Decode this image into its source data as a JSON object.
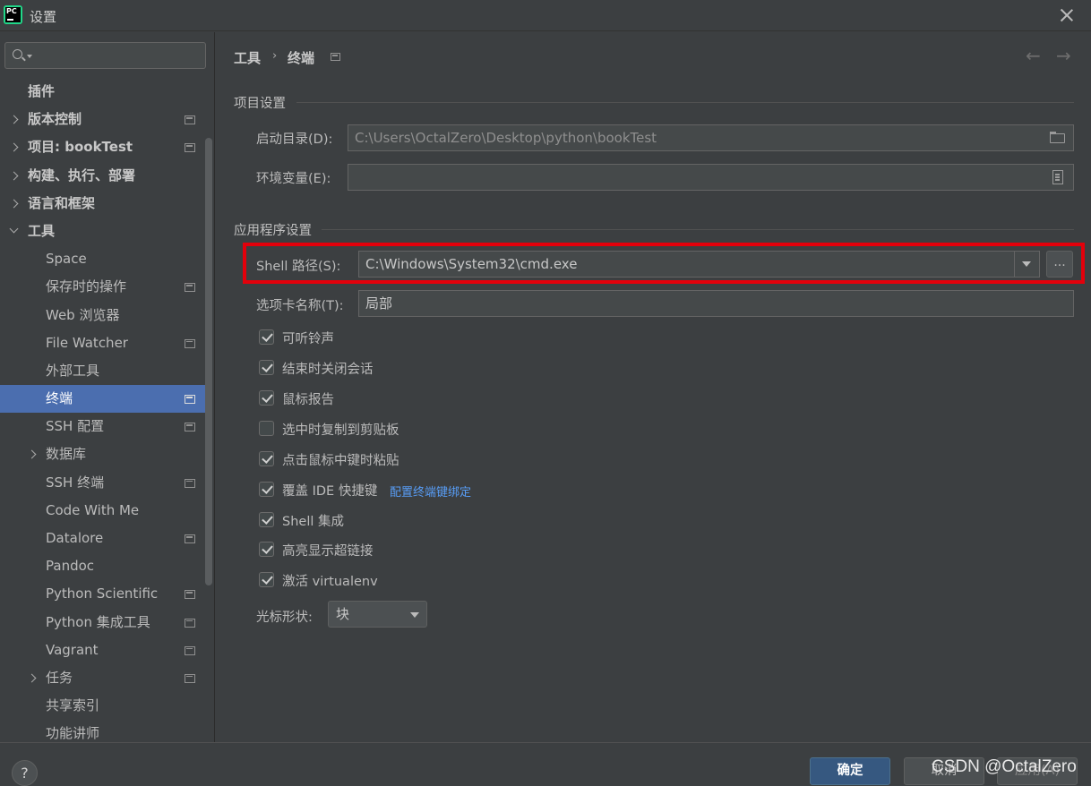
{
  "window": {
    "title": "设置"
  },
  "sidebar": {
    "search": {
      "value": "",
      "placeholder": ""
    },
    "items": [
      {
        "label": "插件",
        "level": 0,
        "expander": "none",
        "bold": true,
        "selected": false,
        "has_icon": false
      },
      {
        "label": "版本控制",
        "level": 0,
        "expander": "right",
        "bold": true,
        "selected": false,
        "has_icon": true
      },
      {
        "label": "项目: bookTest",
        "level": 0,
        "expander": "right",
        "bold": true,
        "selected": false,
        "has_icon": true
      },
      {
        "label": "构建、执行、部署",
        "level": 0,
        "expander": "right",
        "bold": true,
        "selected": false,
        "has_icon": false
      },
      {
        "label": "语言和框架",
        "level": 0,
        "expander": "right",
        "bold": true,
        "selected": false,
        "has_icon": false
      },
      {
        "label": "工具",
        "level": 0,
        "expander": "down",
        "bold": true,
        "selected": false,
        "has_icon": false
      },
      {
        "label": "Space",
        "level": 1,
        "expander": "none",
        "bold": false,
        "selected": false,
        "has_icon": false
      },
      {
        "label": "保存时的操作",
        "level": 1,
        "expander": "none",
        "bold": false,
        "selected": false,
        "has_icon": true
      },
      {
        "label": "Web 浏览器",
        "level": 1,
        "expander": "none",
        "bold": false,
        "selected": false,
        "has_icon": false
      },
      {
        "label": "File Watcher",
        "level": 1,
        "expander": "none",
        "bold": false,
        "selected": false,
        "has_icon": true
      },
      {
        "label": "外部工具",
        "level": 1,
        "expander": "none",
        "bold": false,
        "selected": false,
        "has_icon": false
      },
      {
        "label": "终端",
        "level": 1,
        "expander": "none",
        "bold": false,
        "selected": true,
        "has_icon": true
      },
      {
        "label": "SSH 配置",
        "level": 1,
        "expander": "none",
        "bold": false,
        "selected": false,
        "has_icon": true
      },
      {
        "label": "数据库",
        "level": 1,
        "expander": "right",
        "bold": false,
        "selected": false,
        "has_icon": false
      },
      {
        "label": "SSH 终端",
        "level": 1,
        "expander": "none",
        "bold": false,
        "selected": false,
        "has_icon": true
      },
      {
        "label": "Code With Me",
        "level": 1,
        "expander": "none",
        "bold": false,
        "selected": false,
        "has_icon": false
      },
      {
        "label": "Datalore",
        "level": 1,
        "expander": "none",
        "bold": false,
        "selected": false,
        "has_icon": true
      },
      {
        "label": "Pandoc",
        "level": 1,
        "expander": "none",
        "bold": false,
        "selected": false,
        "has_icon": false
      },
      {
        "label": "Python Scientific",
        "level": 1,
        "expander": "none",
        "bold": false,
        "selected": false,
        "has_icon": true
      },
      {
        "label": "Python 集成工具",
        "level": 1,
        "expander": "none",
        "bold": false,
        "selected": false,
        "has_icon": true
      },
      {
        "label": "Vagrant",
        "level": 1,
        "expander": "none",
        "bold": false,
        "selected": false,
        "has_icon": true
      },
      {
        "label": "任务",
        "level": 1,
        "expander": "right",
        "bold": false,
        "selected": false,
        "has_icon": true
      },
      {
        "label": "共享索引",
        "level": 1,
        "expander": "none",
        "bold": false,
        "selected": false,
        "has_icon": false
      },
      {
        "label": "功能讲师",
        "level": 1,
        "expander": "none",
        "bold": false,
        "selected": false,
        "has_icon": false
      }
    ]
  },
  "breadcrumb": {
    "parent": "工具",
    "separator": "›",
    "current": "终端",
    "back_arrow": "←",
    "forward_arrow": "→"
  },
  "project_settings": {
    "title": "项目设置",
    "start_dir_label": "启动目录(D):",
    "start_dir_value": "C:\\Users\\OctalZero\\Desktop\\python\\bookTest",
    "env_label": "环境变量(E):",
    "env_value": ""
  },
  "app_settings": {
    "title": "应用程序设置",
    "shell_label": "Shell 路径(S):",
    "shell_value": "C:\\Windows\\System32\\cmd.exe",
    "browse_label": "...",
    "tab_name_label": "选项卡名称(T):",
    "tab_name_value": "局部",
    "checkboxes": [
      {
        "label": "可听铃声",
        "checked": true
      },
      {
        "label": "结束时关闭会话",
        "checked": true
      },
      {
        "label": "鼠标报告",
        "checked": true
      },
      {
        "label": "选中时复制到剪贴板",
        "checked": false
      },
      {
        "label": "点击鼠标中键时粘贴",
        "checked": true
      },
      {
        "label": "覆盖 IDE 快捷键",
        "checked": true
      },
      {
        "label": "Shell 集成",
        "checked": true
      },
      {
        "label": "高亮显示超链接",
        "checked": true
      },
      {
        "label": "激活 virtualenv",
        "checked": true
      }
    ],
    "keybinding_link": "配置终端键绑定",
    "cursor_label": "光标形状:",
    "cursor_value": "块"
  },
  "footer": {
    "help": "?",
    "ok": "确定",
    "cancel": "取消",
    "apply": "应用(A)",
    "watermark": "CSDN @OctalZero"
  },
  "colors": {
    "selection": "#4b6eaf",
    "highlight_box": "#e3000b",
    "link": "#589df6",
    "primary_button": "#365880"
  }
}
